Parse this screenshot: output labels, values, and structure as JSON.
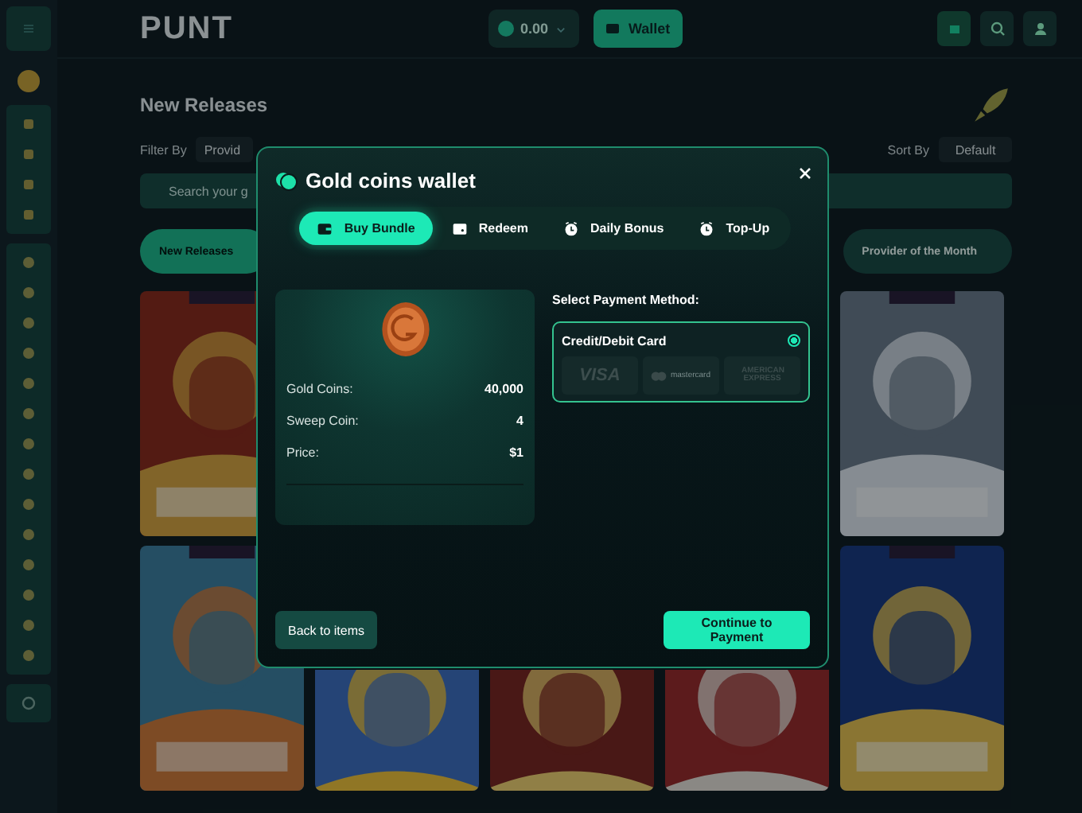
{
  "background": {
    "logo": "PUNT",
    "balance": "0.00",
    "wallet_button": "Wallet",
    "heading": "New Releases",
    "filter_label": "Filter By",
    "filter_value": "Provid",
    "sort_label": "Sort By",
    "sort_value": "Default",
    "search": {
      "placeholder": "Search your g"
    },
    "chips": [
      {
        "label": "New Releases",
        "selected": true
      },
      {
        "label": "Provider of the Month",
        "selected": false
      }
    ]
  },
  "modal": {
    "title": "Gold coins wallet",
    "tabs": [
      {
        "label": "Buy Bundle",
        "selected": true
      },
      {
        "label": "Redeem",
        "selected": false
      },
      {
        "label": "Daily Bonus",
        "selected": false
      },
      {
        "label": "Top-Up",
        "selected": false
      }
    ],
    "bundle": {
      "rows": [
        {
          "label": "Gold Coins:",
          "value": "40,000"
        },
        {
          "label": "Sweep Coin:",
          "value": "4"
        },
        {
          "label": "Price:",
          "value": "$1"
        }
      ]
    },
    "payment": {
      "heading": "Select Payment Method:",
      "methods": [
        {
          "label": "Credit/Debit Card",
          "selected": true,
          "cards": [
            "VISA",
            "mastercard",
            "AMERICAN EXPRESS"
          ]
        }
      ]
    },
    "buttons": [
      {
        "label": "Back to items",
        "kind": "secondary"
      },
      {
        "label": "Continue to Payment",
        "kind": "primary"
      }
    ]
  }
}
